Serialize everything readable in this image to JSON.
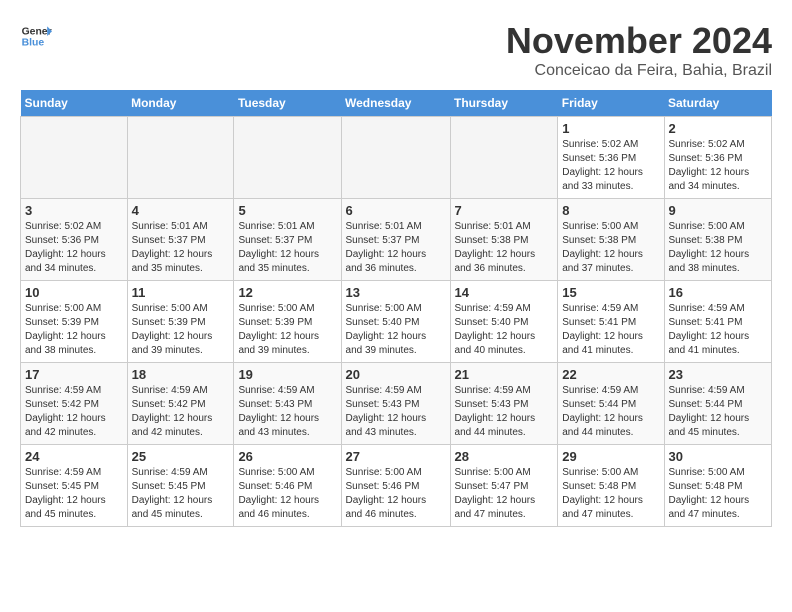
{
  "header": {
    "logo_line1": "General",
    "logo_line2": "Blue",
    "month_year": "November 2024",
    "location": "Conceicao da Feira, Bahia, Brazil"
  },
  "weekdays": [
    "Sunday",
    "Monday",
    "Tuesday",
    "Wednesday",
    "Thursday",
    "Friday",
    "Saturday"
  ],
  "weeks": [
    [
      {
        "day": "",
        "info": ""
      },
      {
        "day": "",
        "info": ""
      },
      {
        "day": "",
        "info": ""
      },
      {
        "day": "",
        "info": ""
      },
      {
        "day": "",
        "info": ""
      },
      {
        "day": "1",
        "info": "Sunrise: 5:02 AM\nSunset: 5:36 PM\nDaylight: 12 hours and 33 minutes."
      },
      {
        "day": "2",
        "info": "Sunrise: 5:02 AM\nSunset: 5:36 PM\nDaylight: 12 hours and 34 minutes."
      }
    ],
    [
      {
        "day": "3",
        "info": "Sunrise: 5:02 AM\nSunset: 5:36 PM\nDaylight: 12 hours and 34 minutes."
      },
      {
        "day": "4",
        "info": "Sunrise: 5:01 AM\nSunset: 5:37 PM\nDaylight: 12 hours and 35 minutes."
      },
      {
        "day": "5",
        "info": "Sunrise: 5:01 AM\nSunset: 5:37 PM\nDaylight: 12 hours and 35 minutes."
      },
      {
        "day": "6",
        "info": "Sunrise: 5:01 AM\nSunset: 5:37 PM\nDaylight: 12 hours and 36 minutes."
      },
      {
        "day": "7",
        "info": "Sunrise: 5:01 AM\nSunset: 5:38 PM\nDaylight: 12 hours and 36 minutes."
      },
      {
        "day": "8",
        "info": "Sunrise: 5:00 AM\nSunset: 5:38 PM\nDaylight: 12 hours and 37 minutes."
      },
      {
        "day": "9",
        "info": "Sunrise: 5:00 AM\nSunset: 5:38 PM\nDaylight: 12 hours and 38 minutes."
      }
    ],
    [
      {
        "day": "10",
        "info": "Sunrise: 5:00 AM\nSunset: 5:39 PM\nDaylight: 12 hours and 38 minutes."
      },
      {
        "day": "11",
        "info": "Sunrise: 5:00 AM\nSunset: 5:39 PM\nDaylight: 12 hours and 39 minutes."
      },
      {
        "day": "12",
        "info": "Sunrise: 5:00 AM\nSunset: 5:39 PM\nDaylight: 12 hours and 39 minutes."
      },
      {
        "day": "13",
        "info": "Sunrise: 5:00 AM\nSunset: 5:40 PM\nDaylight: 12 hours and 39 minutes."
      },
      {
        "day": "14",
        "info": "Sunrise: 4:59 AM\nSunset: 5:40 PM\nDaylight: 12 hours and 40 minutes."
      },
      {
        "day": "15",
        "info": "Sunrise: 4:59 AM\nSunset: 5:41 PM\nDaylight: 12 hours and 41 minutes."
      },
      {
        "day": "16",
        "info": "Sunrise: 4:59 AM\nSunset: 5:41 PM\nDaylight: 12 hours and 41 minutes."
      }
    ],
    [
      {
        "day": "17",
        "info": "Sunrise: 4:59 AM\nSunset: 5:42 PM\nDaylight: 12 hours and 42 minutes."
      },
      {
        "day": "18",
        "info": "Sunrise: 4:59 AM\nSunset: 5:42 PM\nDaylight: 12 hours and 42 minutes."
      },
      {
        "day": "19",
        "info": "Sunrise: 4:59 AM\nSunset: 5:43 PM\nDaylight: 12 hours and 43 minutes."
      },
      {
        "day": "20",
        "info": "Sunrise: 4:59 AM\nSunset: 5:43 PM\nDaylight: 12 hours and 43 minutes."
      },
      {
        "day": "21",
        "info": "Sunrise: 4:59 AM\nSunset: 5:43 PM\nDaylight: 12 hours and 44 minutes."
      },
      {
        "day": "22",
        "info": "Sunrise: 4:59 AM\nSunset: 5:44 PM\nDaylight: 12 hours and 44 minutes."
      },
      {
        "day": "23",
        "info": "Sunrise: 4:59 AM\nSunset: 5:44 PM\nDaylight: 12 hours and 45 minutes."
      }
    ],
    [
      {
        "day": "24",
        "info": "Sunrise: 4:59 AM\nSunset: 5:45 PM\nDaylight: 12 hours and 45 minutes."
      },
      {
        "day": "25",
        "info": "Sunrise: 4:59 AM\nSunset: 5:45 PM\nDaylight: 12 hours and 45 minutes."
      },
      {
        "day": "26",
        "info": "Sunrise: 5:00 AM\nSunset: 5:46 PM\nDaylight: 12 hours and 46 minutes."
      },
      {
        "day": "27",
        "info": "Sunrise: 5:00 AM\nSunset: 5:46 PM\nDaylight: 12 hours and 46 minutes."
      },
      {
        "day": "28",
        "info": "Sunrise: 5:00 AM\nSunset: 5:47 PM\nDaylight: 12 hours and 47 minutes."
      },
      {
        "day": "29",
        "info": "Sunrise: 5:00 AM\nSunset: 5:48 PM\nDaylight: 12 hours and 47 minutes."
      },
      {
        "day": "30",
        "info": "Sunrise: 5:00 AM\nSunset: 5:48 PM\nDaylight: 12 hours and 47 minutes."
      }
    ]
  ]
}
